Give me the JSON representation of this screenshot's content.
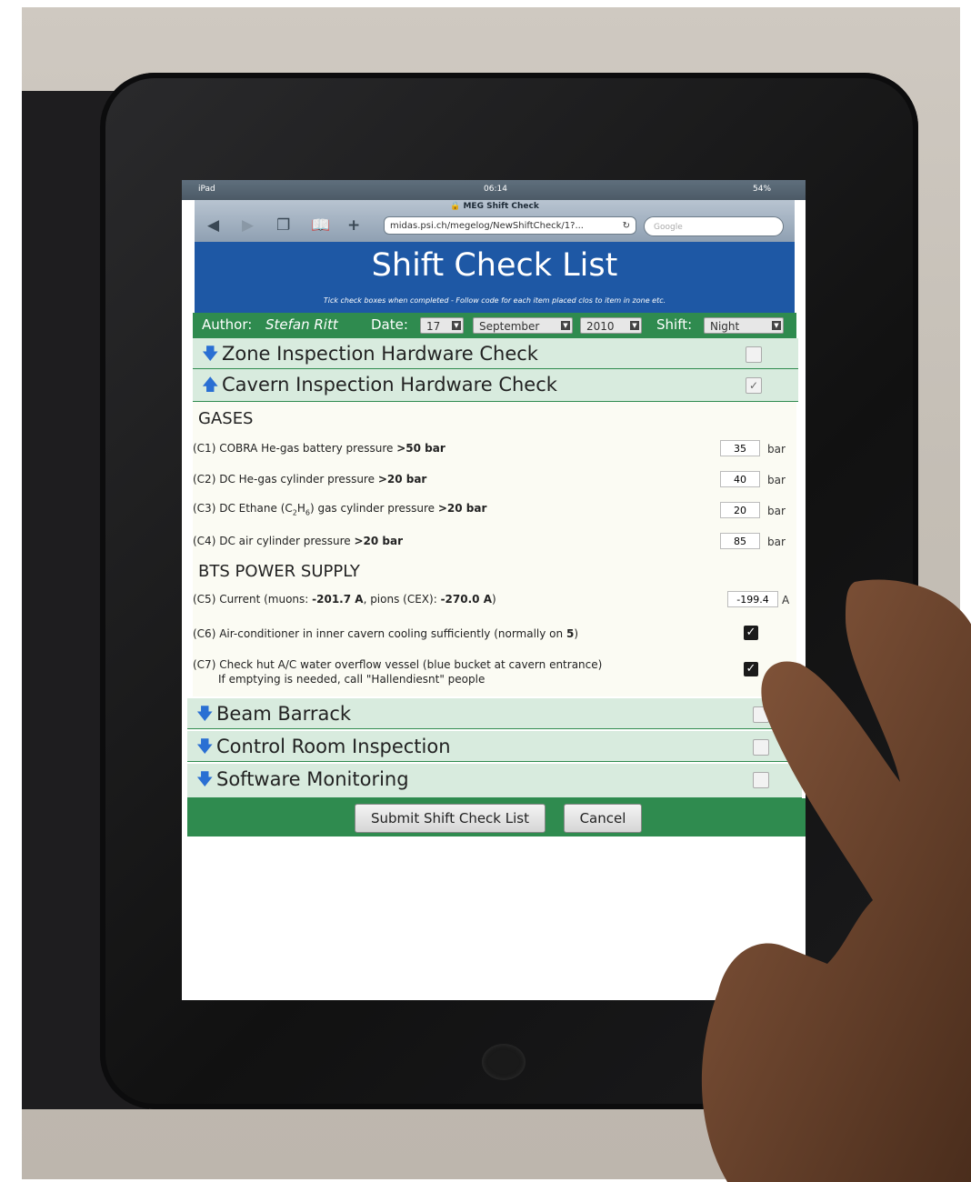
{
  "status_bar": {
    "device": "iPad",
    "time": "06:14",
    "battery": "54%"
  },
  "browser": {
    "page_title": "MEG Shift Check",
    "url": "midas.psi.ch/megelog/NewShiftCheck/1?...",
    "search_placeholder": "Google"
  },
  "header": {
    "title": "Shift Check List",
    "subtitle": "Tick check boxes when completed - Follow code for each item placed clos to item in zone etc."
  },
  "author_bar": {
    "author_label": "Author:",
    "author_name": "Stefan Ritt",
    "date_label": "Date:",
    "day": "17",
    "month": "September",
    "year": "2010",
    "shift_label": "Shift:",
    "shift": "Night"
  },
  "sections": [
    {
      "title": "Zone Inspection Hardware Check",
      "expanded": false,
      "checked": false
    },
    {
      "title": "Cavern Inspection Hardware Check",
      "expanded": true,
      "checked": true
    },
    {
      "title": "Beam Barrack",
      "expanded": false,
      "checked": false
    },
    {
      "title": "Control Room Inspection",
      "expanded": false,
      "checked": false
    },
    {
      "title": "Software Monitoring",
      "expanded": false,
      "checked": false
    }
  ],
  "cavern": {
    "gases_heading": "GASES",
    "items": [
      {
        "code": "(C1)",
        "text": "COBRA He-gas battery pressure",
        "limit": ">50 bar",
        "value": "35",
        "unit": "bar"
      },
      {
        "code": "(C2)",
        "text": "DC He-gas cylinder pressure",
        "limit": ">20 bar",
        "value": "40",
        "unit": "bar"
      },
      {
        "code": "(C3)",
        "text": "DC Ethane (C2H6) gas cylinder pressure",
        "limit": ">20 bar",
        "value": "20",
        "unit": "bar"
      },
      {
        "code": "(C4)",
        "text": "DC air cylinder pressure",
        "limit": ">20 bar",
        "value": "85",
        "unit": "bar"
      }
    ],
    "bts_heading": "BTS POWER SUPPLY",
    "c5": {
      "code": "(C5)",
      "text_a": "Current (muons:",
      "muons": "-201.7 A",
      "text_b": ", pions (CEX):",
      "pions": "-270.0 A",
      "text_c": ")",
      "value": "-199.4",
      "unit": "A"
    },
    "c6": {
      "code": "(C6)",
      "text": "Air-conditioner in inner cavern cooling sufficiently (normally on",
      "bold": "5",
      "tail": ")",
      "checked": true
    },
    "c7": {
      "code": "(C7)",
      "line1": "Check hut A/C water overflow vessel (blue bucket at cavern entrance)",
      "line2": "If emptying is needed, call \"Hallendiesnt\" people",
      "checked": true
    }
  },
  "buttons": {
    "submit": "Submit Shift Check List",
    "cancel": "Cancel"
  },
  "colors": {
    "header_blue": "#1e58a5",
    "bar_green": "#2f8b4f",
    "section_bg": "#d8ebde"
  }
}
